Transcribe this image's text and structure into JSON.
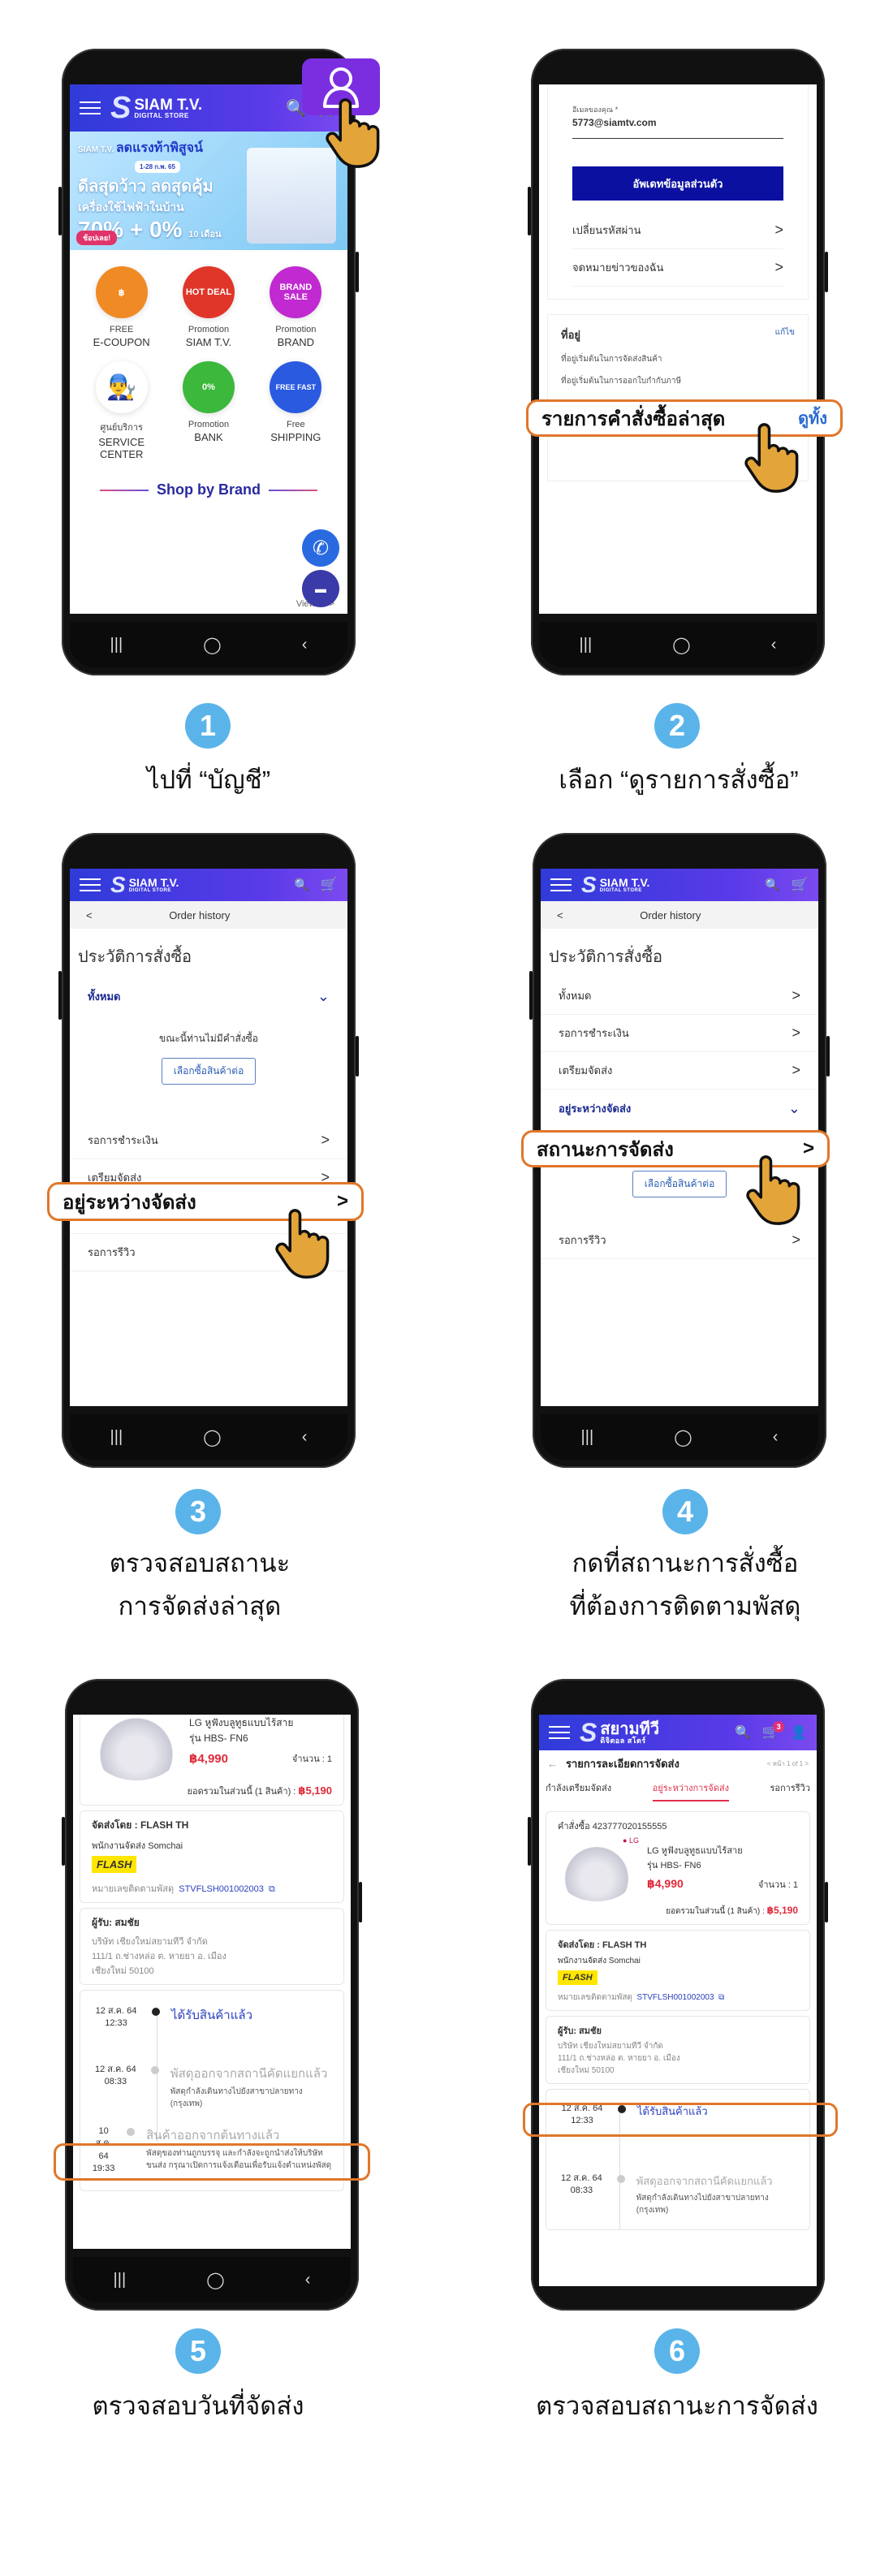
{
  "colors": {
    "accent": "#2f3bd9",
    "step": "#5ab4ea",
    "highlight": "#e0772a",
    "price": "#e02a3a"
  },
  "nav": {
    "recent": "|||",
    "home": "◯",
    "back": "‹"
  },
  "header": {
    "brand": "SIAM T.V.",
    "sub": "DIGITAL STORE",
    "logo": "S",
    "menu_icon": "hamburger-icon",
    "search_icon": "🔍",
    "cart_icon": "🛒"
  },
  "p1": {
    "banner": {
      "brand": "SIAM T.V.",
      "headline": "ลดแรงท้าพิสูจน์",
      "dates": "1-28 ก.พ. 65",
      "line1": "ดีลสุดว้าว ลดสุดคุ้ม",
      "line2": "เครื่องใช้ไฟฟ้าในบ้าน",
      "pct1": "70%",
      "plus": "+",
      "pct2": "0%",
      "months": "10 เดือน",
      "cta": "ช้อปเลย!"
    },
    "grid": [
      {
        "badge": "฿",
        "top": "FREE",
        "bottom": "E-COUPON",
        "color": "#f08a24"
      },
      {
        "badge": "HOT DEAL",
        "top": "Promotion",
        "bottom": "SIAM T.V.",
        "color": "#e0362a"
      },
      {
        "badge": "BRAND SALE",
        "top": "Promotion",
        "bottom": "BRAND",
        "color": "#c02ad0"
      },
      {
        "badge": "👨‍🔧",
        "top": "ศูนย์บริการ",
        "bottom": "SERVICE CENTER",
        "color": "#2a4fd0"
      },
      {
        "badge": "0%",
        "top": "Promotion",
        "bottom": "BANK",
        "color": "#3cb83c"
      },
      {
        "badge": "FREE FAST",
        "top": "Free",
        "bottom": "SHIPPING",
        "color": "#2a5ae0"
      }
    ],
    "shop_by_brand": "Shop by Brand",
    "view_all": "View all >",
    "phone_icon": "✆",
    "chat_icon": "▬",
    "user_icon": "user-icon"
  },
  "p2": {
    "email_label": "อีเมลของคุณ *",
    "email_value": "5773@siamtv.com",
    "update_btn": "อัพเดทข้อมูลส่วนตัว",
    "rows": [
      "เปลี่ยนรหัสผ่าน",
      "จดหมายข่าวของฉัน"
    ],
    "addr_title": "ที่อยู่",
    "addr_edit": "แก้ไข",
    "addr1": "ที่อยู่เริ่มต้นในการจัดส่งสินค้า",
    "addr2": "ที่อยู่เริ่มต้นในการออกใบกำกับภาษี",
    "highlight": "รายการคำสั่งซื้อล่าสุด",
    "view_all": "ดูทั้ง"
  },
  "orders": {
    "back": "<",
    "title": "Order history",
    "page_title": "ประวัติการสั่งซื้อ",
    "all": "ทั้งหมด",
    "empty": "ขณะนี้ท่านไม่มีคำสั่งซื้อ",
    "continue": "เลือกซื้อสินค้าต่อ",
    "pending_pay": "รอการชำระเงิน",
    "preparing": "เตรียมจัดส่ง",
    "shipping": "อยู่ระหว่างจัดส่ง",
    "review": "รอการรีวิว",
    "status": "สถานะการจัดส่ง",
    "chev": ">",
    "down": "⌄"
  },
  "detail": {
    "order_no": "คำสั่งซื้อ 423777020155555",
    "lg": "● LG",
    "name": "LG หูฟังบลูทูธแบบไร้สาย",
    "model": "รุ่น HBS- FN6",
    "price": "฿4,990",
    "qty": "จำนวน : 1",
    "subtotal_label": "ยอดรวมในส่วนนี้ (1 สินค้า) :",
    "subtotal": "฿5,190",
    "carrier": "จัดส่งโดย : FLASH TH",
    "courier": "พนักงานจัดส่ง Somchai",
    "flash": "FLASH",
    "tracking_label": "หมายเลขติดตามพัสดุ",
    "tracking": "STVFLSH001002003",
    "copy_icon": "⧉",
    "receiver": "ผู้รับ: สมชัย",
    "addr1": "บริษัท เชียงใหม่สยามทีวี จำกัด",
    "addr2": "111/1 ถ.ช่างหล่อ ต. หายยา อ. เมือง",
    "addr3": "เชียงใหม่ 50100",
    "timeline": [
      {
        "date": "12 ส.ค. 64",
        "time": "12:33",
        "title": "ได้รับสินค้าแล้ว",
        "desc": ""
      },
      {
        "date": "12 ส.ค. 64",
        "time": "08:33",
        "title": "พัสดุออกจากสถานีคัดแยกแล้ว",
        "desc": "พัสดุกำลังเดินทางไปยังสาขาปลายทาง (กรุงเทพ)"
      },
      {
        "date": "10 ส.ค. 64",
        "time": "19:33",
        "title": "สินค้าออกจากต้นทางแล้ว",
        "desc": "พัสดุของท่านถูกบรรจุ และกำลังจะถูกนำส่งให้บริษัทขนส่ง กรุณาเปิดการแจ้งเตือนเพื่อรับแจ้งตำแหน่งพัสดุ"
      }
    ]
  },
  "p6": {
    "logo_th": "สยามทีวี",
    "logo_sub": "ดิจิตอล สโตร์",
    "cart_badge": "3",
    "back": "←",
    "title": "รายการละเอียดการจัดส่ง",
    "pager": "< หน้า 1 of 1 >",
    "tabs": [
      "กำลังเตรียมจัดส่ง",
      "อยู่ระหว่างการจัดส่ง",
      "รอการรีวิว"
    ],
    "user_icon": "👤"
  },
  "steps": [
    {
      "num": "1",
      "caption": "ไปที่ “บัญชี”"
    },
    {
      "num": "2",
      "caption": "เลือก “ดูรายการสั่งซื้อ”"
    },
    {
      "num": "3",
      "caption": "ตรวจสอบสถานะ\nการจัดส่งล่าสุด"
    },
    {
      "num": "4",
      "caption": "กดที่สถานะการสั่งซื้อ\nที่ต้องการติดตามพัสดุ"
    },
    {
      "num": "5",
      "caption": "ตรวจสอบวันที่จัดส่ง"
    },
    {
      "num": "6",
      "caption": "ตรวจสอบสถานะการจัดส่ง"
    }
  ]
}
